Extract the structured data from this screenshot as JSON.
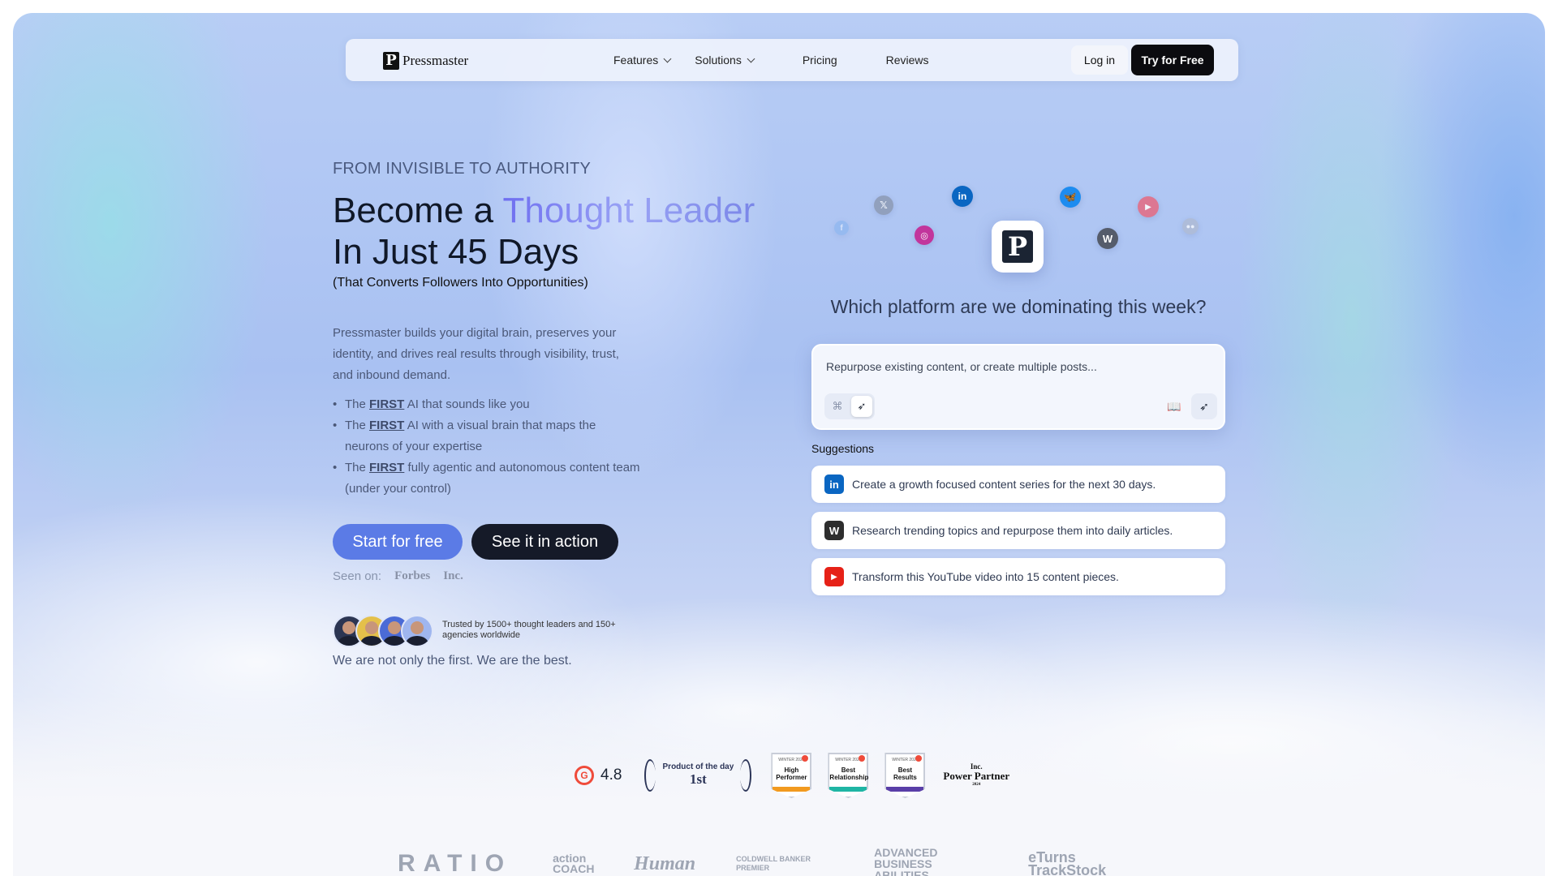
{
  "nav": {
    "brand": "Pressmaster",
    "brand_mark": "P",
    "links": [
      {
        "label": "Features",
        "has_dropdown": true
      },
      {
        "label": "Solutions",
        "has_dropdown": true
      },
      {
        "label": "Pricing",
        "has_dropdown": false
      },
      {
        "label": "Reviews",
        "has_dropdown": false
      }
    ],
    "login": "Log in",
    "try": "Try for Free"
  },
  "hero": {
    "eyebrow": "FROM INVISIBLE TO AUTHORITY",
    "title_pre": "Become a ",
    "title_highlight": "Thought Leader",
    "title_line2": "In Just 45 Days",
    "subtitle": "(That Converts Followers Into Opportunities)",
    "description": "Pressmaster builds your digital brain, preserves your identity, and drives real results through visibility, trust, and inbound demand.",
    "bullets": [
      {
        "pre": "The ",
        "bold": "FIRST",
        "post": " AI that sounds like you"
      },
      {
        "pre": "The ",
        "bold": "FIRST",
        "post": " AI with a visual brain that maps the neurons of your expertise"
      },
      {
        "pre": "The ",
        "bold": "FIRST",
        "post": " fully agentic and autonomous content team (under your control)"
      }
    ],
    "cta_primary": "Start for free",
    "cta_secondary": "See it in action",
    "seen_on_label": "Seen on:",
    "seen_on": [
      "Forbes",
      "Inc."
    ],
    "trusted": "Trusted by 1500+ thought leaders and 150+ agencies worldwide",
    "tagline": "We are not only the first. We are the best."
  },
  "platforms": {
    "icons": [
      "facebook-icon",
      "x-icon",
      "instagram-icon",
      "linkedin-icon",
      "bluesky-icon",
      "wordpress-icon",
      "youtube-icon",
      "medium-icon"
    ],
    "center_mark": "P"
  },
  "composer": {
    "question": "Which platform are we dominating this week?",
    "placeholder": "Repurpose existing content, or create multiple posts...",
    "suggestions_label": "Suggestions",
    "suggestions": [
      {
        "icon": "linkedin-icon",
        "text": "Create a growth focused content series for the next 30 days."
      },
      {
        "icon": "wordpress-icon",
        "text": "Research trending topics and repurpose them into daily articles."
      },
      {
        "icon": "youtube-icon",
        "text": "Transform this YouTube video into 15 content pieces."
      }
    ]
  },
  "awards": {
    "g2_rating": "4.8",
    "pod_line1": "Product of the day",
    "pod_line2": "1st",
    "badges": [
      {
        "top": "WINTER 2025",
        "title": "High Performer",
        "band": "#f29a1f"
      },
      {
        "top": "WINTER 2025",
        "title": "Best Relationship",
        "band": "#1fb5a4"
      },
      {
        "top": "WINTER 2025",
        "title": "Best Results",
        "band": "#5a3fa8"
      }
    ],
    "inc_line1": "Inc.",
    "inc_line2": "Power Partner",
    "inc_line3": "2024"
  },
  "logos": [
    "RATIO",
    "action COACH",
    "Human",
    "COLDWELL BANKER PREMIER",
    "ADVANCED BUSINESS ABILITIES",
    "eTurns TrackStock"
  ],
  "colors": {
    "accent": "#5b7be6",
    "dark": "#151a28",
    "linkedin": "#0a66c2",
    "youtube": "#e62117",
    "wordpress": "#2d2d2d"
  }
}
